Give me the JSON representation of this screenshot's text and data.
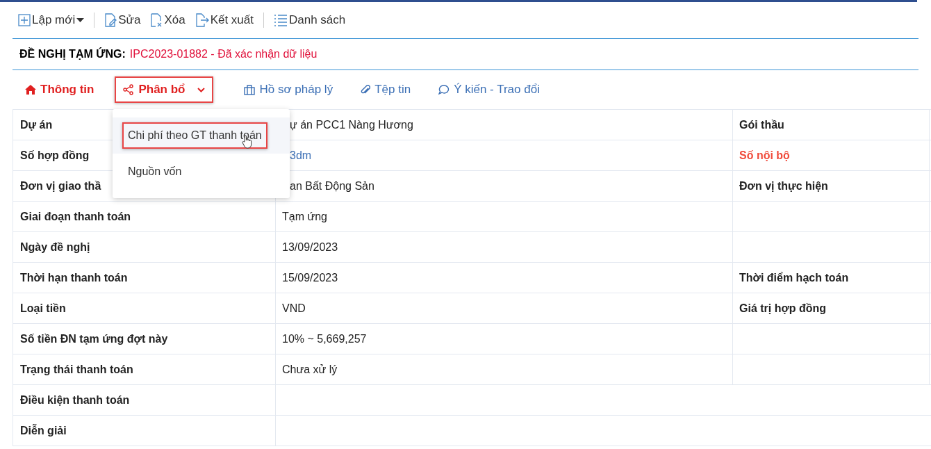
{
  "toolbar": [
    {
      "label": "Lập mới",
      "caret": true
    },
    {
      "label": "Sửa",
      "caret": false
    },
    {
      "label": "Xóa",
      "caret": false
    },
    {
      "label": "Kết xuất",
      "caret": false
    },
    {
      "label": "Danh sách",
      "caret": false
    }
  ],
  "heading": {
    "label": "ĐỀ NGHỊ TẠM ỨNG:",
    "value": "IPC2023-01882 - Đã xác nhận dữ liệu"
  },
  "tabs": [
    {
      "label": "Thông tin",
      "selected": true,
      "expanded": false
    },
    {
      "label": "Phân bổ",
      "selected": true,
      "expanded": true
    },
    {
      "label": "Hồ sơ pháp lý",
      "selected": false,
      "expanded": false
    },
    {
      "label": "Tệp tin",
      "selected": false,
      "expanded": false
    },
    {
      "label": "Ý kiến - Trao đổi",
      "selected": false,
      "expanded": false
    }
  ],
  "menu": [
    {
      "label": "Chi phí theo GT thanh toán",
      "selected": true
    },
    {
      "label": "Nguồn vốn",
      "selected": false
    }
  ],
  "rows": [
    {
      "label": "Dự án",
      "value": "ự án PCC1 Nàng Hương",
      "kind": "covered",
      "label2": "Gói thầu",
      "label2_highlight": false
    },
    {
      "label": "Số hợp đồng",
      "value": "3dm",
      "kind": "covered-link",
      "label2": "Số nội bộ",
      "label2_highlight": true
    },
    {
      "label": "Đơn vị giao thầ",
      "value": "an Bất Động Sản",
      "kind": "covered",
      "label2": "Đơn vị thực hiện",
      "label2_highlight": false
    },
    {
      "label": "Giai đoạn thanh toán",
      "value": "Tạm ứng",
      "kind": "plain"
    },
    {
      "label": "Ngày đề nghị",
      "value": "13/09/2023",
      "kind": "plain"
    },
    {
      "label": "Thời hạn thanh toán",
      "value": "15/09/2023",
      "kind": "plain",
      "label2": "Thời điểm hạch toán",
      "label2_highlight": false
    },
    {
      "label": "Loại tiền",
      "value": "VND",
      "kind": "plain",
      "label2": "Giá trị hợp đồng",
      "label2_highlight": false
    },
    {
      "label": "Số tiền ĐN tạm ứng đợt này",
      "value": "10% ~ 5,669,257",
      "kind": "plain"
    },
    {
      "label": "Trạng thái thanh toán",
      "value": "Chưa xử lý",
      "kind": "plain"
    },
    {
      "label": "Điều kiện thanh toán",
      "kind": "wide"
    },
    {
      "label": "Diễn giải",
      "kind": "wide"
    }
  ]
}
